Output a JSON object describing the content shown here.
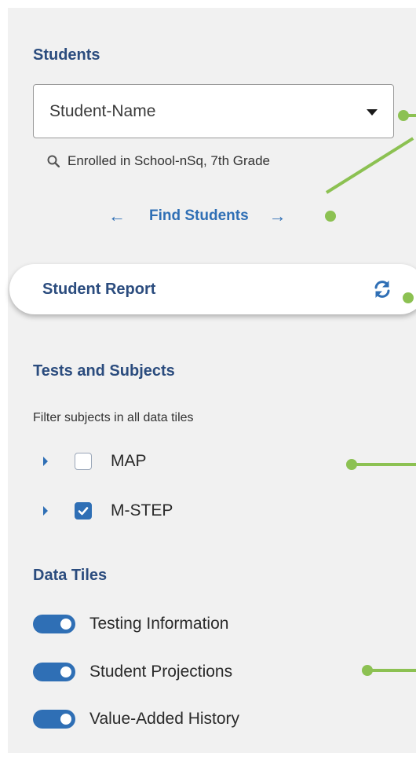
{
  "students": {
    "heading": "Students",
    "selected_student": "Student-Name",
    "enrollment": "Enrolled in School-nSq, 7th Grade",
    "find_label": "Find Students"
  },
  "report": {
    "label": "Student Report"
  },
  "tests": {
    "heading": "Tests and Subjects",
    "description": "Filter subjects in all data tiles",
    "subjects": [
      {
        "label": "MAP",
        "checked": false
      },
      {
        "label": "M-STEP",
        "checked": true
      }
    ]
  },
  "tiles": {
    "heading": "Data Tiles",
    "items": [
      {
        "label": "Testing Information",
        "enabled": true
      },
      {
        "label": "Student Projections",
        "enabled": true
      },
      {
        "label": "Value-Added History",
        "enabled": true
      }
    ]
  },
  "colors": {
    "accent": "#2f6fb5",
    "heading": "#2b4c7e",
    "annotation": "#8cc152",
    "panel": "#f1f1f1"
  }
}
